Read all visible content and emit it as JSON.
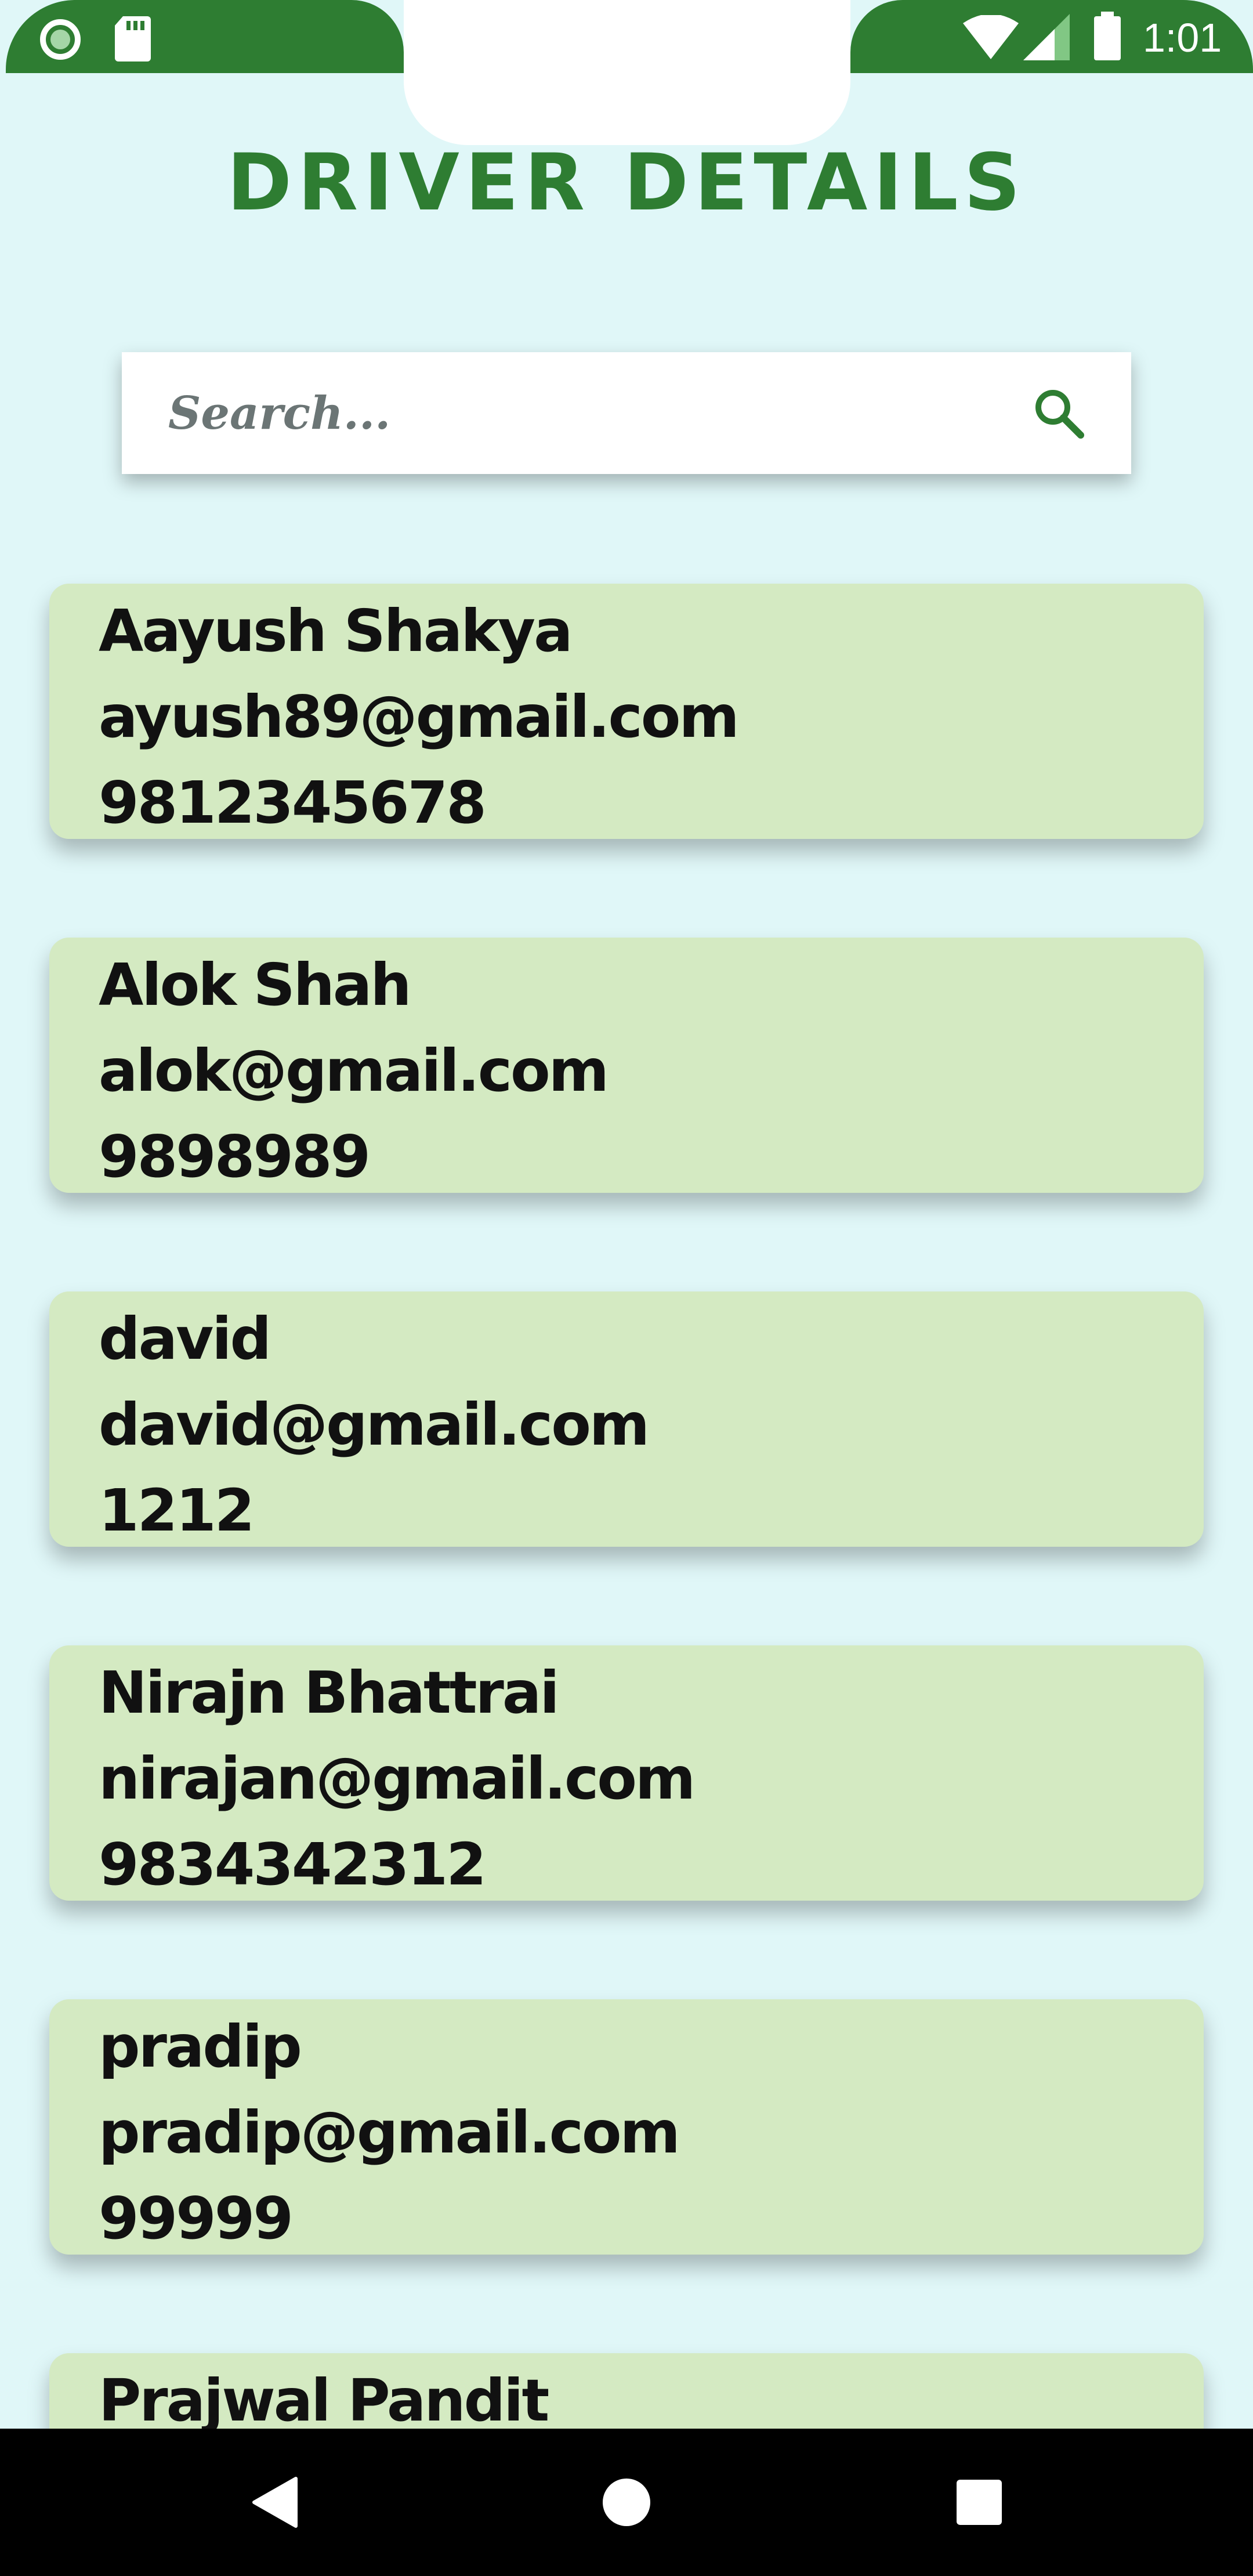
{
  "status_bar": {
    "time": "1:01",
    "icons_left": [
      "circle-icon",
      "sd-card-icon"
    ],
    "icons_right": [
      "wifi-icon",
      "signal-icon",
      "battery-icon"
    ],
    "color": "#2e7d32"
  },
  "header": {
    "title": "DRIVER DETAILS",
    "color": "#2e7d32"
  },
  "search": {
    "placeholder": "Search...",
    "value": "",
    "icon": "search-icon"
  },
  "drivers": [
    {
      "name": "Aayush Shakya",
      "email": "ayush89@gmail.com",
      "phone": "9812345678"
    },
    {
      "name": "Alok Shah",
      "email": "alok@gmail.com",
      "phone": "9898989"
    },
    {
      "name": "david",
      "email": "david@gmail.com",
      "phone": "1212"
    },
    {
      "name": "Nirajn Bhattrai",
      "email": "nirajan@gmail.com",
      "phone": "9834342312"
    },
    {
      "name": "pradip",
      "email": "pradip@gmail.com",
      "phone": "99999"
    },
    {
      "name": "Prajwal Pandit",
      "email": "",
      "phone": ""
    }
  ],
  "nav_bar": {
    "buttons": [
      "back-icon",
      "home-icon",
      "recents-icon"
    ]
  },
  "colors": {
    "background": "#e0f7f8",
    "card": "#d4eac2",
    "accent": "#2e7d32"
  }
}
